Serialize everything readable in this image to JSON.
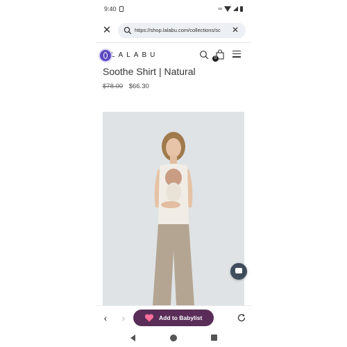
{
  "status_bar": {
    "time": "9:40"
  },
  "browser": {
    "url": "https://shop.lalabu.com/collections/sc",
    "close_icon": "close-icon",
    "clear_icon": "clear-icon"
  },
  "site": {
    "logo": "LALABU",
    "cart_count": "0"
  },
  "product": {
    "title": "Soothe Shirt | Natural",
    "original_price": "$78.00",
    "sale_price": "$66.30",
    "image_desc_colors": {
      "background": "#dfe3e5",
      "pants": "#b4a593",
      "top": "#f1ede6"
    }
  },
  "toolbar": {
    "babylist_label": "Add to Babylist",
    "babylist_color": "#5a2d58"
  },
  "colors": {
    "accessibility_button": "#5b49c0",
    "chat_button": "#3f4c5c"
  }
}
